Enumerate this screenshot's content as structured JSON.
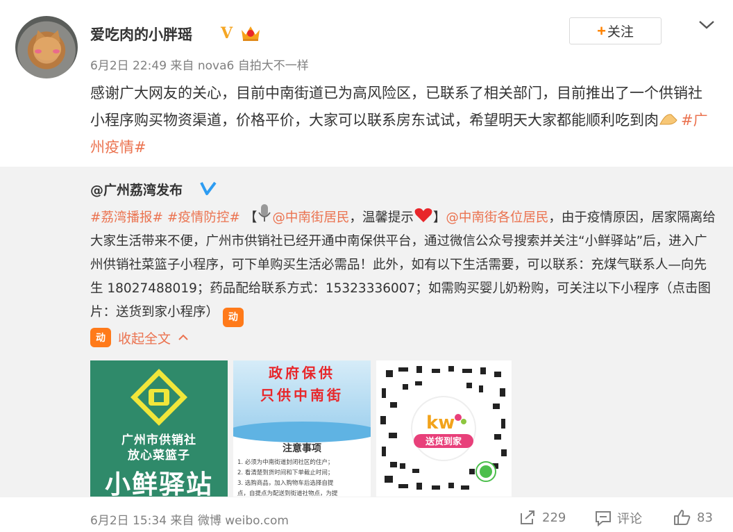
{
  "post": {
    "username": "爱吃肉的小胖瑶",
    "verified_mark": "V",
    "follow_label": "关注",
    "follow_plus": "+",
    "meta": "6月2日 22:49 来自 nova6 自拍大不一样",
    "text_main": "感谢广大网友的关心，目前中南街道已为高风险区，已联系了相关部门，目前推出了一个供销社小程序购买物资渠道，价格平价，大家可以联系房东试试，希望明天大家都能顺利吃到肉",
    "hashtag": "#广州疫情#"
  },
  "repost": {
    "author": "@广州荔湾发布",
    "tag1": "#荔湾播报#",
    "tag2": "#疫情防控#",
    "bracket_open": "【",
    "mention1": "@中南街居民",
    "reminder": "，温馨提示",
    "bracket_close": "】",
    "mention2": "@中南街各位居民",
    "body": "，由于疫情原因，居家隔离给大家生活带来不便，广州市供销社已经开通中南保供平台，通过微信公众号搜索并关注“小鲜驿站”后，进入广州供销社菜篮子小程序，可下单购买生活必需品！此外，如有以下生活需要，可以联系：充煤气联系人—向先生  18027488019；药品配给联系方式：15323336007；如需购买婴儿奶粉购，可关注以下小程序（点击图片：送货到家小程序）",
    "mini_icon_text": "动",
    "collapse_label": "收起全文",
    "images": {
      "img1": {
        "line1": "广州市供销社",
        "line2": "放心菜篮子",
        "line3": "小鲜驿站"
      },
      "img2": {
        "title1": "政府保供",
        "title2": "只供中南街",
        "notice": "注意事项",
        "rules": [
          "1. 必须为中南街道封闭社区的住户；",
          "2. 看清楚到货时间和下单截止时间；",
          "3. 选购商品，加入购物车后选择自提",
          "   点，自提点为配送到街道社物点，为提"
        ]
      },
      "img3": {
        "brand": "kw",
        "banner": "送货到家"
      }
    },
    "footer": {
      "meta": "6月2日 15:34 来自 微博 weibo.com",
      "shares": "229",
      "comments_label": "评论",
      "likes": "83"
    }
  },
  "colors": {
    "accent": "#eb7350",
    "follow_plus": "#ff8200",
    "repost_bg": "#f2f2f2",
    "verified_gold": "#f5a623",
    "verified_blue": "#2d9cf2"
  },
  "icons": [
    "crown-icon",
    "verified-icon",
    "chevron-down-icon",
    "microphone-icon",
    "heart-icon",
    "hands-icon",
    "mini-program-icon",
    "chevron-up-icon",
    "share-icon",
    "comment-icon",
    "like-icon",
    "wechat-mini-icon"
  ]
}
